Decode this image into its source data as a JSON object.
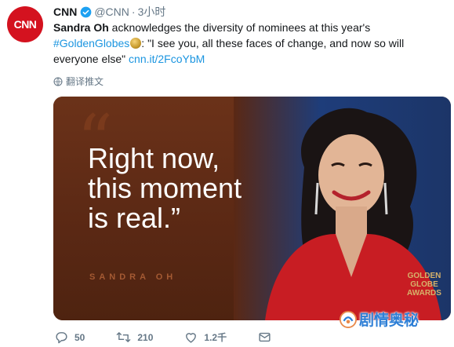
{
  "author": {
    "avatar_text": "CNN",
    "display_name": "CNN",
    "handle": "@CNN",
    "separator": "·",
    "time": "3小时",
    "avatar_color": "#d4121f"
  },
  "tweet": {
    "name_bold": "Sandra Oh",
    "text_1": " acknowledges the diversity of nominees at this year's ",
    "hashtag": "#GoldenGlobes",
    "text_2": ": \"I see you, all these faces of change, and now so will everyone else\" ",
    "link": "cnn.it/2FcoYbM",
    "link_color": "#1b95e0"
  },
  "translate": {
    "label": "翻译推文",
    "icon": "globe-icon"
  },
  "media": {
    "quote_mark": "“",
    "quote": "Right now,\nthis moment\nis real.”",
    "attribution": "SANDRA OH",
    "logo_text": "GOLDEN\nGLOBE\nAWARDS"
  },
  "watermark": {
    "text": "剧情奥秘"
  },
  "actions": {
    "reply_count": "50",
    "retweet_count": "210",
    "like_count": "1.2千",
    "icons": [
      "reply-icon",
      "retweet-icon",
      "like-icon",
      "message-icon"
    ]
  }
}
